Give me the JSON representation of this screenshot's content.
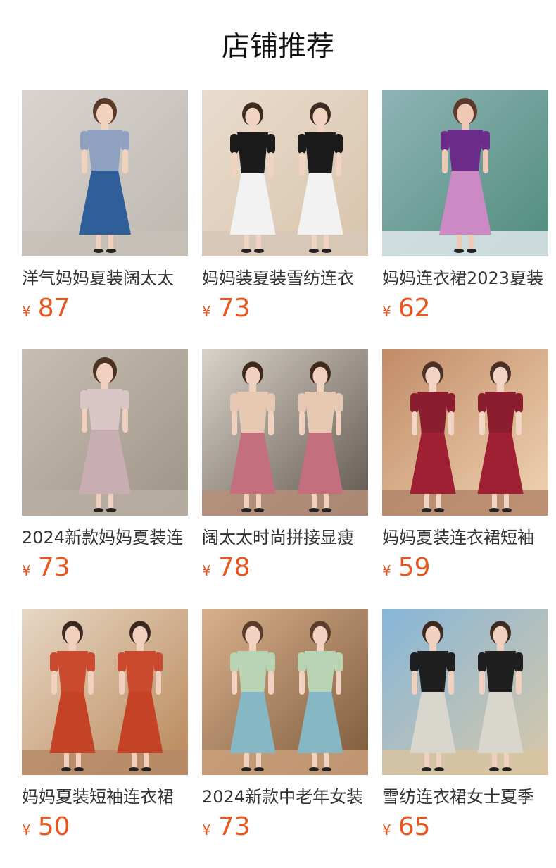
{
  "header": {
    "title": "店铺推荐"
  },
  "colors": {
    "price": "#e8561f",
    "text": "#333333",
    "title": "#111111"
  },
  "products": [
    {
      "name": "洋气妈妈夏装阔太太",
      "currency": "¥",
      "price": "87",
      "image_icon": "product-photo-blue-floral-top-blue-skirt",
      "palette": {
        "bg": "#d9d4cf",
        "bg2": "#bdb7b0",
        "top": "#8ea1bf",
        "bottom": "#2f5e98",
        "skin": "#f1d2bd",
        "hair": "#5a3b29",
        "floor": "#c7c0b7"
      }
    },
    {
      "name": "妈妈装夏装雪纺连衣",
      "currency": "¥",
      "price": "73",
      "image_icon": "product-photo-black-cardigan-floral-dress",
      "palette": {
        "bg": "#e9dccd",
        "bg2": "#d8c4ac",
        "top": "#1b1b1b",
        "bottom": "#f2f2f2",
        "skin": "#f1d3c1",
        "hair": "#3d2a20",
        "floor": "#d7c8b7"
      }
    },
    {
      "name": "妈妈连衣裙2023夏装",
      "currency": "¥",
      "price": "62",
      "image_icon": "product-photo-purple-dress-poolside",
      "palette": {
        "bg": "#8fb3b5",
        "bg2": "#4f8c7d",
        "top": "#6b2b88",
        "bottom": "#cc8ac5",
        "skin": "#f0c9b6",
        "hair": "#5b3a2d",
        "floor": "#dfe7ea"
      }
    },
    {
      "name": "2024新款妈妈夏装连",
      "currency": "¥",
      "price": "73",
      "image_icon": "product-photo-pink-floral-print-dress",
      "palette": {
        "bg": "#c7beb3",
        "bg2": "#9e9386",
        "top": "#d9c7c6",
        "bottom": "#c8aeb2",
        "skin": "#efd0bf",
        "hair": "#4b3225",
        "floor": "#b9aea2"
      }
    },
    {
      "name": "阔太太时尚拼接显瘦",
      "currency": "¥",
      "price": "78",
      "image_icon": "product-photo-pink-and-red-patchwork-dresses",
      "palette": {
        "bg": "#d9d2c8",
        "bg2": "#5f564d",
        "top": "#e6c8b3",
        "bottom": "#c46f7e",
        "skin": "#f0d0be",
        "hair": "#3f291d",
        "floor": "#b78f79"
      }
    },
    {
      "name": "妈妈夏装连衣裙短袖",
      "currency": "¥",
      "price": "59",
      "image_icon": "product-photo-burgundy-short-sleeve-dress",
      "palette": {
        "bg": "#c28b66",
        "bg2": "#f0d5b4",
        "top": "#8b1e2e",
        "bottom": "#9e2032",
        "skin": "#f2d4c4",
        "hair": "#4a3025",
        "floor": "#b38568"
      }
    },
    {
      "name": "妈妈夏装短袖连衣裙",
      "currency": "¥",
      "price": "50",
      "image_icon": "product-photo-red-print-dress",
      "palette": {
        "bg": "#e7d7c5",
        "bg2": "#b98758",
        "top": "#c94a2e",
        "bottom": "#c44226",
        "skin": "#f1d0bd",
        "hair": "#3b2820",
        "floor": "#b68a67"
      }
    },
    {
      "name": "2024新款中老年女装",
      "currency": "¥",
      "price": "73",
      "image_icon": "product-photo-green-and-blue-dresses",
      "palette": {
        "bg": "#d9b08c",
        "bg2": "#7b5a3a",
        "top": "#b9d4b3",
        "bottom": "#86b7c4",
        "skin": "#f1d2c0",
        "hair": "#5b3d2b",
        "floor": "#caa07a"
      }
    },
    {
      "name": "雪纺连衣裙女士夏季",
      "currency": "¥",
      "price": "65",
      "image_icon": "product-photo-beach-floral-dresses",
      "palette": {
        "bg": "#86b6d8",
        "bg2": "#d8c8a8",
        "top": "#1f1f1f",
        "bottom": "#d9d6ce",
        "skin": "#f0d1bf",
        "hair": "#3f2a22",
        "floor": "#d8c3a1"
      }
    }
  ]
}
